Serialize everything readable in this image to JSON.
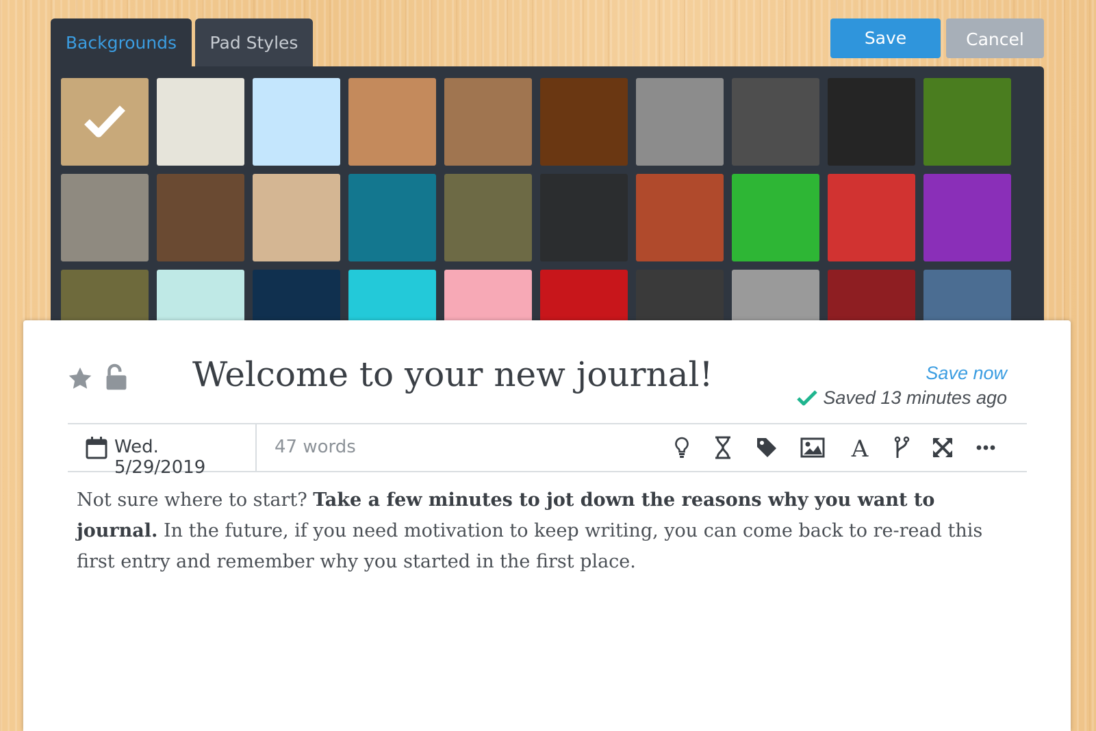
{
  "picker": {
    "tabs": [
      {
        "label": "Backgrounds",
        "active": true
      },
      {
        "label": "Pad Styles",
        "active": false
      }
    ],
    "selected_index": 0,
    "swatches": [
      {
        "name": "swatch-light-wood",
        "color": "#c8a97a"
      },
      {
        "name": "swatch-cream",
        "color": "#e6e4da"
      },
      {
        "name": "swatch-light-blue",
        "color": "#c4e6fd"
      },
      {
        "name": "swatch-cork",
        "color": "#c48a5c"
      },
      {
        "name": "swatch-wood-planks",
        "color": "#a07550"
      },
      {
        "name": "swatch-parquet",
        "color": "#6a3712"
      },
      {
        "name": "swatch-gray-fabric",
        "color": "#8c8c8c"
      },
      {
        "name": "swatch-asphalt",
        "color": "#4e4e4e"
      },
      {
        "name": "swatch-black-leather",
        "color": "#252525"
      },
      {
        "name": "swatch-grass",
        "color": "#4a7d1f"
      },
      {
        "name": "swatch-pebbles",
        "color": "#8f8a80"
      },
      {
        "name": "swatch-cracked-earth",
        "color": "#6a4a32"
      },
      {
        "name": "swatch-sand",
        "color": "#d4b693"
      },
      {
        "name": "swatch-water",
        "color": "#13778f"
      },
      {
        "name": "swatch-tree-bark",
        "color": "#6d6a45"
      },
      {
        "name": "swatch-chalkboard",
        "color": "#2b2d2f"
      },
      {
        "name": "swatch-brick-wall",
        "color": "#b04a2c"
      },
      {
        "name": "swatch-green-leaf",
        "color": "#2eb635"
      },
      {
        "name": "swatch-red-metal",
        "color": "#d13331"
      },
      {
        "name": "swatch-paint-splatter",
        "color": "#8a2fb8"
      },
      {
        "name": "swatch-camouflage",
        "color": "#6e6a3c"
      },
      {
        "name": "swatch-sky-cloud",
        "color": "#bfe9e6"
      },
      {
        "name": "swatch-blue-coral",
        "color": "#10304f"
      },
      {
        "name": "swatch-turquoise-swirl",
        "color": "#23c9d9"
      },
      {
        "name": "swatch-pink-argyle",
        "color": "#f7a9b6"
      },
      {
        "name": "swatch-red-plaid",
        "color": "#c8161b"
      },
      {
        "name": "swatch-black-white-plaid",
        "color": "#3a3a3a"
      },
      {
        "name": "swatch-gray-knit",
        "color": "#9a9a9a"
      },
      {
        "name": "swatch-red-black-plaid",
        "color": "#8e1e22"
      },
      {
        "name": "swatch-denim",
        "color": "#4b6d92"
      }
    ]
  },
  "buttons": {
    "save": "Save",
    "cancel": "Cancel"
  },
  "entry": {
    "title": "Welcome to your new journal!",
    "save_now": "Save now",
    "saved_status": "Saved 13 minutes ago",
    "date": "Wed. 5/29/2019",
    "word_count": "47 words",
    "body_intro": "Not sure where to start? ",
    "body_bold": "Take a few minutes to jot down the reasons why you want to journal.",
    "body_rest": " In the future, if you need motivation to keep writing, you can come back to re-read this first entry and remember why you started in the first place."
  },
  "toolbar_icons": [
    "lightbulb-icon",
    "hourglass-icon",
    "tag-icon",
    "image-icon",
    "font-icon",
    "branch-icon",
    "fullscreen-icon",
    "more-icon"
  ],
  "colors": {
    "accent": "#2f95dc",
    "saved_check": "#1fb58f",
    "panel": "#2f3640"
  }
}
